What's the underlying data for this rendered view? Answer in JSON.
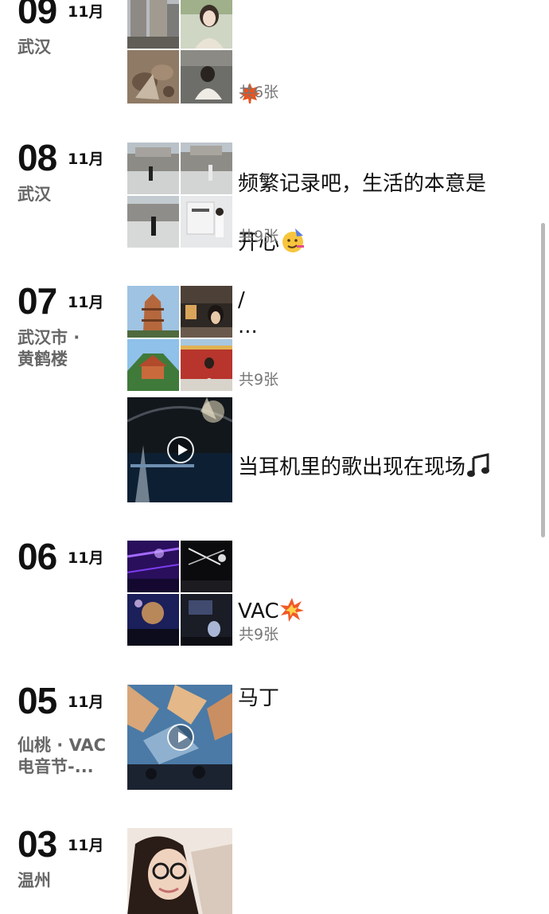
{
  "colors": {
    "primary_text": "#111111",
    "secondary_text": "#666666",
    "count_text": "#777777",
    "scrollbar": "#b9b9b9"
  },
  "posts": [
    {
      "day": "09",
      "month": "11月",
      "location": "武汉",
      "caption": "",
      "caption_emoji": "maple-leaf",
      "count": "共6张"
    },
    {
      "day": "08",
      "month": "11月",
      "location": "武汉",
      "caption": "频繁记录吧，生活的本意是\n开心",
      "caption_emoji": "party-face",
      "count": "共9张"
    },
    {
      "day": "07",
      "month": "11月",
      "location": "武汉市 ·\n黄鹤楼",
      "caption": "/\n...",
      "count": "共9张",
      "video_caption": "当耳机里的歌出现在现场",
      "video_caption_emoji": "music-notes"
    },
    {
      "day": "06",
      "month": "11月",
      "location": "",
      "caption": "VAC",
      "caption_emoji": "collision",
      "count": "共9张"
    },
    {
      "day": "05",
      "month": "11月",
      "location": "仙桃 · VAC\n电音节-...",
      "caption": "马丁"
    },
    {
      "day": "03",
      "month": "11月",
      "location": "温州",
      "caption": ""
    }
  ]
}
